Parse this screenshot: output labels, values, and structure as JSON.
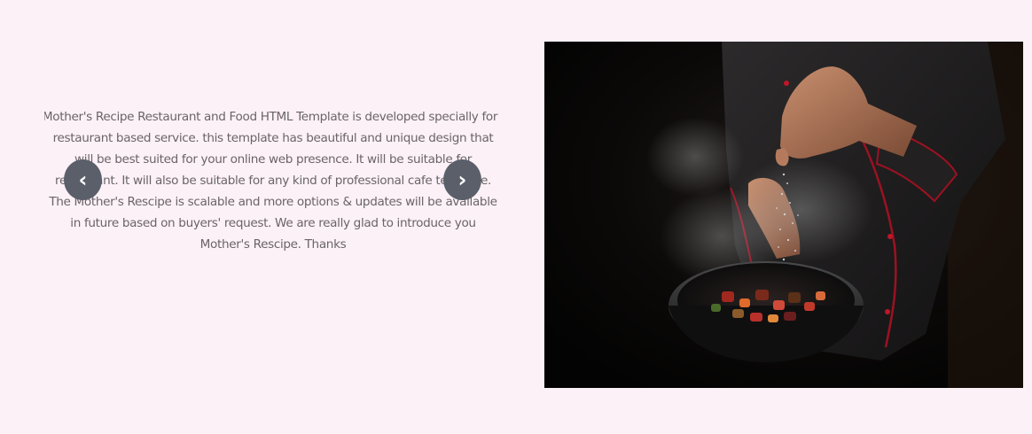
{
  "about": {
    "description": "Mother's Recipe Restaurant and Food HTML Template is developed specially for restaurant based service. this template has beautiful and unique design that will be best suited for your online web presence. It will be suitable for restaurant. It will also be suitable for any kind of professional cafe template. The Mother's Rescipe is scalable and more options & updates will be available in future based on buyers' request. We are really glad to introduce you Mother's Rescipe. Thanks",
    "prev_label": "‹",
    "next_label": "›"
  },
  "image": {
    "subject": "chef seasoning vegetables in a frying pan",
    "background_color": "#050505",
    "accent_color": "#c0162a"
  }
}
